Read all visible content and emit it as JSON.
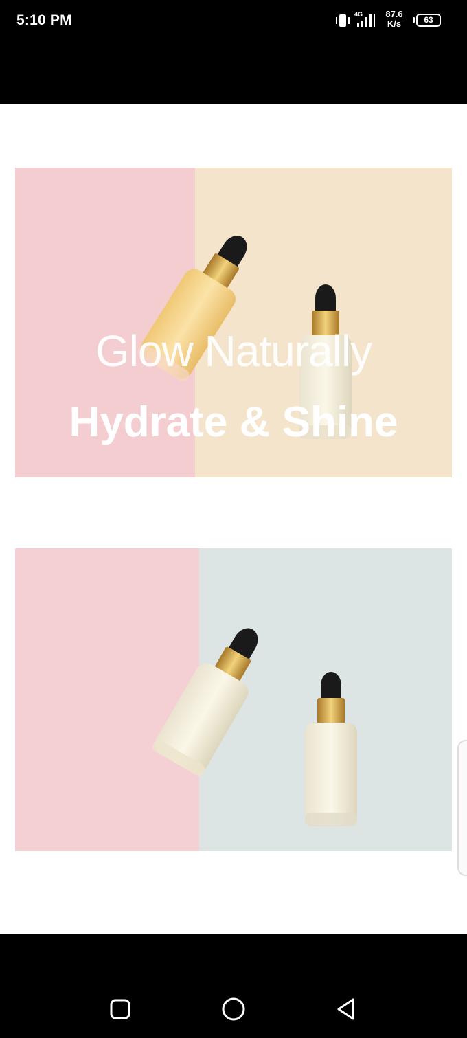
{
  "status_bar": {
    "time": "5:10 PM",
    "network": "4G",
    "speed_value": "87.6",
    "speed_unit": "K/s",
    "battery": "63"
  },
  "post": {
    "image_1": {
      "title_light": "Glow Naturally",
      "title_bold": "Hydrate & Shine",
      "left_color": "#f4cdd0",
      "right_color": "#f4e4cc"
    },
    "image_2": {
      "left_color": "#f4cfd3",
      "right_color": "#dde5e4"
    }
  },
  "nav_bar": {
    "icons": [
      "recent-apps-icon",
      "home-icon",
      "back-icon"
    ]
  }
}
